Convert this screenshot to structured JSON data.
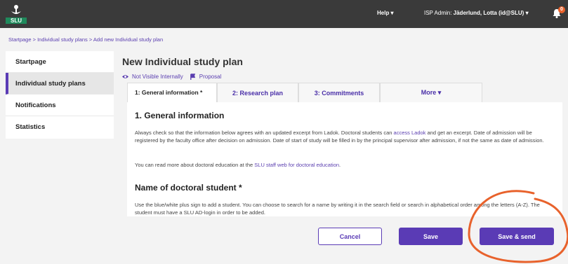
{
  "colors": {
    "accent": "#5a3bb5",
    "topbar": "#3a3a3a",
    "badge": "#e8622c",
    "annotation": "#e8622c"
  },
  "topbar": {
    "logo_text": "SLU",
    "help_label": "Help ▾",
    "admin_role": "ISP Admin: ",
    "admin_name": "Jäderlund, Lotta (id@SLU) ▾",
    "notification_count": "0"
  },
  "breadcrumb": "Startpage > Individual study plans > Add new Individual study plan",
  "sidebar": {
    "items": [
      {
        "label": "Startpage"
      },
      {
        "label": "Individual study plans"
      },
      {
        "label": "Notifications"
      },
      {
        "label": "Statistics"
      }
    ]
  },
  "main": {
    "title": "New Individual study plan",
    "visibility": "Not Visible Internally",
    "stage": "Proposal",
    "tabs": [
      {
        "label": "1: General information *"
      },
      {
        "label": "2: Research plan"
      },
      {
        "label": "3: Commitments"
      },
      {
        "label": "More ▾"
      }
    ],
    "section_title": "1. General information",
    "para1_a": "Always check so that the information below agrees with an updated excerpt from Ladok. Doctoral students can ",
    "para1_link": "access Ladok",
    "para1_b": " and get an excerpt. Date of admission will be registered by the faculty office after decision on admission. Date of start of study will be filled in by the principal supervisor after admission, if not the same as date of admission.",
    "para2_a": "You can read more about doctoral education at the ",
    "para2_link": "SLU staff web for doctoral education",
    "para2_b": ".",
    "section2_title": "Name of doctoral student *",
    "para3": "Use the blue/white plus sign to add a student. You can choose to search for a name by writing it in the search field or search in alphabetical order among the letters (A-Z). The student must have a SLU AD-login in order to be added."
  },
  "footer": {
    "cancel_label": "Cancel",
    "save_label": "Save",
    "send_label": "Save & send"
  }
}
